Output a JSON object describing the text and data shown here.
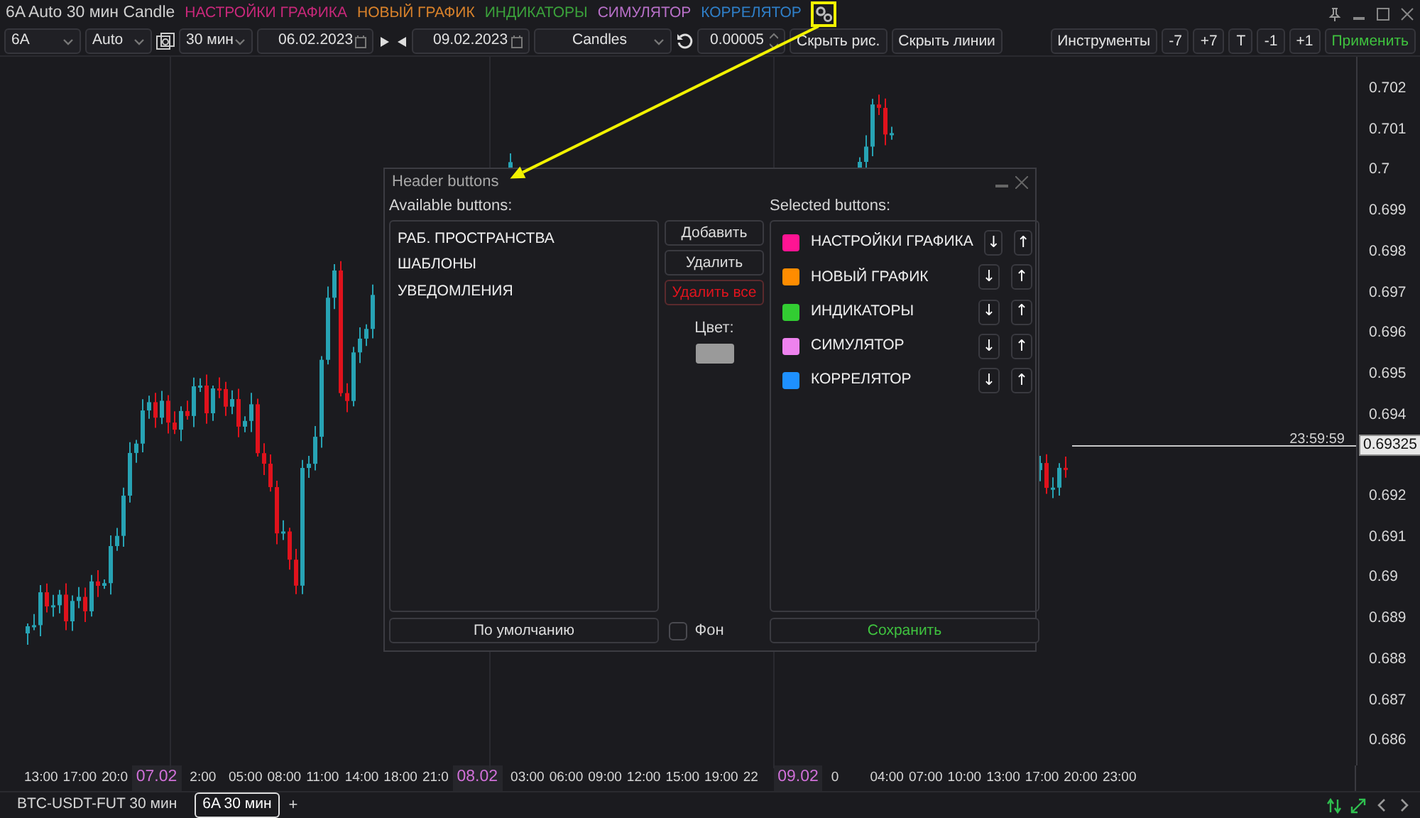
{
  "header": {
    "title": "6A Auto 30 мин Candle",
    "buttons": [
      {
        "label": "НАСТРОЙКИ ГРАФИКА",
        "color": "#c8287a"
      },
      {
        "label": "НОВЫЙ ГРАФИК",
        "color": "#d9822b"
      },
      {
        "label": "ИНДИКАТОРЫ",
        "color": "#3ba13b"
      },
      {
        "label": "СИМУЛЯТОР",
        "color": "#b870c8"
      },
      {
        "label": "КОРРЕЛЯТОР",
        "color": "#2f7fc8"
      }
    ]
  },
  "toolbar": {
    "symbol": "6A",
    "scale": "Auto",
    "interval": "30 мин",
    "date_from": "06.02.2023",
    "date_to": "09.02.2023",
    "chart_type": "Candles",
    "step": "0.00005",
    "left_buttons": [
      "Скрыть рис.",
      "Скрыть линии"
    ],
    "right_buttons": [
      "Инструменты",
      "-7",
      "+7",
      "T",
      "-1",
      "+1"
    ],
    "apply": "Применить"
  },
  "price_axis": {
    "ticks": [
      "0.702",
      "0.701",
      "0.7",
      "0.699",
      "0.698",
      "0.697",
      "0.696",
      "0.695",
      "0.694",
      "0.692",
      "0.691",
      "0.69",
      "0.689",
      "0.688",
      "0.687",
      "0.686"
    ],
    "last_price": "0.69325",
    "countdown": "23:59:59"
  },
  "time_axis": [
    {
      "text": "13:00",
      "kind": "time"
    },
    {
      "text": "17:00",
      "kind": "time"
    },
    {
      "text": "20:0",
      "kind": "time"
    },
    {
      "text": "07.02",
      "kind": "date"
    },
    {
      "text": "2:00",
      "kind": "time"
    },
    {
      "text": "05:00",
      "kind": "time"
    },
    {
      "text": "08:00",
      "kind": "time"
    },
    {
      "text": "11:00",
      "kind": "time"
    },
    {
      "text": "14:00",
      "kind": "time"
    },
    {
      "text": "18:00",
      "kind": "time"
    },
    {
      "text": "21:0",
      "kind": "time"
    },
    {
      "text": "08.02",
      "kind": "date"
    },
    {
      "text": "03:00",
      "kind": "time"
    },
    {
      "text": "06:00",
      "kind": "time"
    },
    {
      "text": "09:00",
      "kind": "time"
    },
    {
      "text": "12:00",
      "kind": "time"
    },
    {
      "text": "15:00",
      "kind": "time"
    },
    {
      "text": "19:00",
      "kind": "time"
    },
    {
      "text": "22",
      "kind": "time"
    },
    {
      "text": "09.02",
      "kind": "date"
    },
    {
      "text": "0",
      "kind": "time"
    },
    {
      "text": "04:00",
      "kind": "time"
    },
    {
      "text": "07:00",
      "kind": "time"
    },
    {
      "text": "10:00",
      "kind": "time"
    },
    {
      "text": "13:00",
      "kind": "time"
    },
    {
      "text": "17:00",
      "kind": "time"
    },
    {
      "text": "20:00",
      "kind": "time"
    },
    {
      "text": "23:00",
      "kind": "time"
    }
  ],
  "dialog": {
    "title": "Header buttons",
    "available_label": "Available buttons:",
    "available": [
      "РАБ. ПРОСТРАНСТВА",
      "ШАБЛОНЫ",
      "УВЕДОМЛЕНИЯ"
    ],
    "actions": [
      {
        "label": "Добавить",
        "kind": "normal"
      },
      {
        "label": "Удалить",
        "kind": "normal"
      },
      {
        "label": "Удалить все",
        "kind": "danger"
      }
    ],
    "color_picker": {
      "label": "Цвет:",
      "color": "#9a9a9a"
    },
    "selected_label": "Selected buttons:",
    "selected": [
      {
        "label": "НАСТРОЙКИ ГРАФИКА",
        "color": "#ff1493",
        "down": "↓",
        "up": "↑"
      },
      {
        "label": "НОВЫЙ ГРАФИК",
        "color": "#ff8c00",
        "down": "↓",
        "up": "↑"
      },
      {
        "label": "ИНДИКАТОРЫ",
        "color": "#32cd32",
        "down": "↓",
        "up": "↑"
      },
      {
        "label": "СИМУЛЯТОР",
        "color": "#ee82ee",
        "down": "↓",
        "up": "↑"
      },
      {
        "label": "КОРРЕЛЯТОР",
        "color": "#1e90ff",
        "down": "↓",
        "up": "↑"
      }
    ],
    "default_button": "По умолчанию",
    "background": {
      "label": "Фон",
      "checked": false
    },
    "save_button": "Сохранить"
  },
  "tabs": [
    {
      "label": "BTC-USDT-FUT 30 мин",
      "selected": false
    },
    {
      "label": "6A 30 мин",
      "selected": true
    }
  ],
  "add_tab": "+"
}
